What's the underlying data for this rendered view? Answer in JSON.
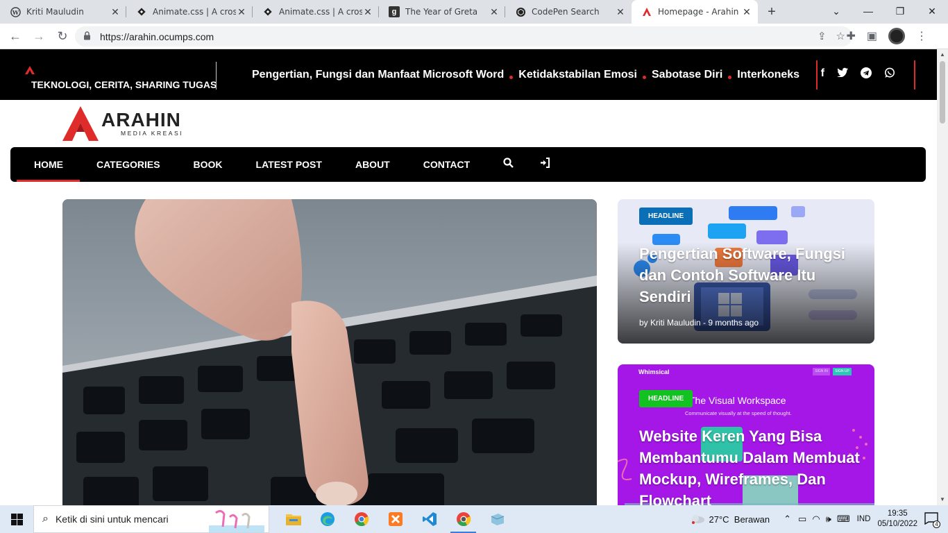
{
  "browser": {
    "tabs": [
      {
        "title": "Kriti Mauludin",
        "favicon": "wordpress-icon"
      },
      {
        "title": "Animate.css | A cross-",
        "favicon": "animate-icon"
      },
      {
        "title": "Animate.css | A cross-",
        "favicon": "animate-icon"
      },
      {
        "title": "The Year of Greta",
        "favicon": "g-icon"
      },
      {
        "title": "CodePen Search",
        "favicon": "codepen-icon"
      },
      {
        "title": "Homepage - Arahin M",
        "favicon": "arahin-icon",
        "active": true
      }
    ],
    "url": "https://arahin.ocumps.com"
  },
  "site": {
    "tagline": "TEKNOLOGI, CERITA, SHARING TUGAS",
    "ticker": [
      "Pengertian, Fungsi dan Manfaat Microsoft Word",
      "Ketidakstabilan Emosi",
      "Sabotase Diri",
      "Interkoneks"
    ],
    "social": [
      "facebook-icon",
      "twitter-icon",
      "telegram-icon",
      "whatsapp-icon"
    ],
    "logo": {
      "name": "ARAHIN",
      "sub": "MEDIA KREASI"
    },
    "nav": [
      "HOME",
      "CATEGORIES",
      "BOOK",
      "LATEST POST",
      "ABOUT",
      "CONTACT"
    ],
    "accent": "#e02b2b"
  },
  "cards": [
    {
      "badge": "HEADLINE",
      "title": "Pengertian Software, Fungsi dan Contoh Software Itu Sendiri",
      "meta": "by Kriti Mauludin - 9 months ago"
    },
    {
      "badge": "HEADLINE",
      "title": "Website Keren Yang Bisa Membantumu Dalam Membuat Mockup, Wireframes, Dan Flowchart",
      "brand": "Whimsical",
      "signin": "SIGN IN",
      "signup": "SIGN UP",
      "heading": "The Visual Workspace",
      "sub": "Communicate visually at the speed of thought."
    }
  ],
  "taskbar": {
    "search_placeholder": "Ketik di sini untuk mencari",
    "weather": "27°C  Berawan",
    "lang": "IND",
    "time": "19:35",
    "date": "05/10/2022",
    "notifications": "4"
  }
}
